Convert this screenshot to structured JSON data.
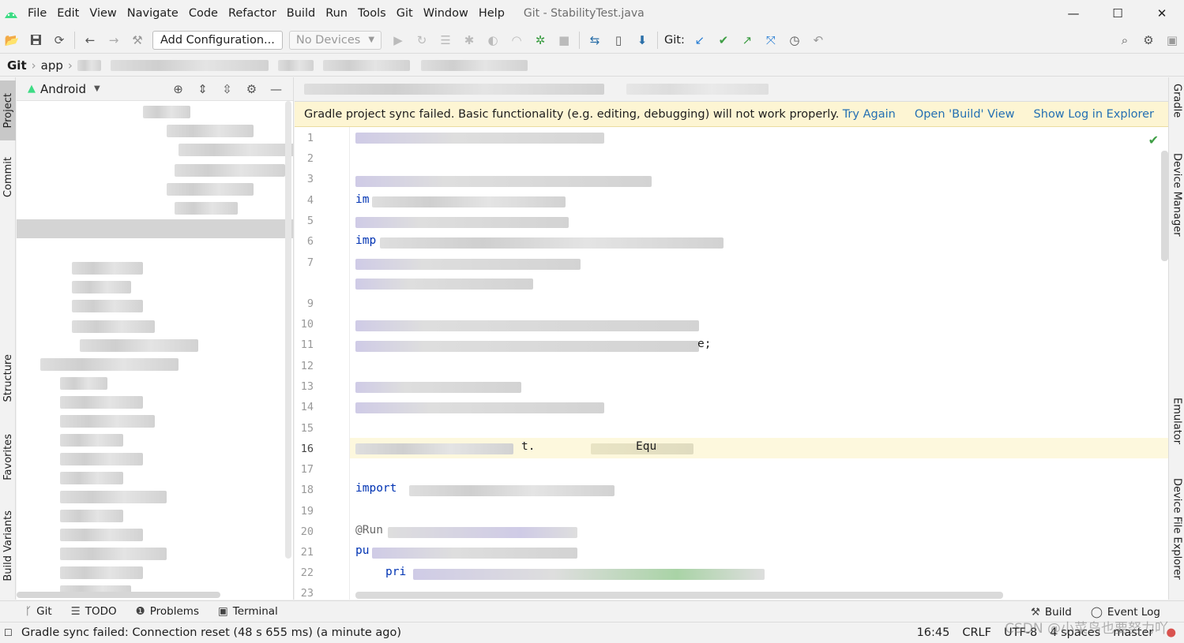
{
  "menu": {
    "items": [
      "File",
      "Edit",
      "View",
      "Navigate",
      "Code",
      "Refactor",
      "Build",
      "Run",
      "Tools",
      "Git",
      "Window",
      "Help"
    ],
    "title": "Git - StabilityTest.java"
  },
  "window_controls": {
    "minimize": "—",
    "maximize": "☐",
    "close": "✕"
  },
  "toolbar": {
    "add_configuration": "Add Configuration...",
    "no_devices": "No Devices",
    "git_label": "Git:"
  },
  "breadcrumb": {
    "root": "Git",
    "module": "app"
  },
  "project_panel": {
    "view_name": "Android"
  },
  "left_tabs": {
    "project": "Project",
    "commit": "Commit",
    "structure": "Structure",
    "favorites": "Favorites",
    "build_variants": "Build Variants"
  },
  "right_tabs": {
    "gradle": "Gradle",
    "device_manager": "Device Manager",
    "emulator": "Emulator",
    "device_file_explorer": "Device File Explorer"
  },
  "banner": {
    "message": "Gradle project sync failed. Basic functionality (e.g. editing, debugging) will not work properly.",
    "try_again": "Try Again",
    "open_build_view": "Open 'Build' View",
    "show_log": "Show Log in Explorer"
  },
  "editor": {
    "line_numbers": [
      "1",
      "2",
      "3",
      "4",
      "5",
      "6",
      "7",
      "9",
      "10",
      "11",
      "12",
      "13",
      "14",
      "15",
      "16",
      "17",
      "18",
      "19",
      "20",
      "21",
      "22",
      "23"
    ],
    "current_line": "16",
    "visible_fragments": {
      "l4": "im",
      "l6": "imp",
      "l11": "e;",
      "l16a": "t.",
      "l16b": "Equ",
      "l18": "import",
      "l20": "@Run",
      "l21": "pu",
      "l22": "pri"
    }
  },
  "bottom_tabs": {
    "git": "Git",
    "todo": "TODO",
    "problems": "Problems",
    "terminal": "Terminal",
    "build": "Build",
    "event_log": "Event Log"
  },
  "status": {
    "message": "Gradle sync failed: Connection reset (48 s 655 ms) (a minute ago)",
    "position": "16:45",
    "line_sep": "CRLF",
    "encoding": "UTF-8",
    "indent": "4 spaces",
    "branch": "master"
  },
  "watermark": "CSDN @小菜鸟也要努力吖",
  "colors": {
    "link": "#2470b3",
    "banner_bg": "#fdf5d3",
    "current_line": "#fdf8dd",
    "keyword": "#0033b3",
    "ok_check": "#3e9e45"
  }
}
